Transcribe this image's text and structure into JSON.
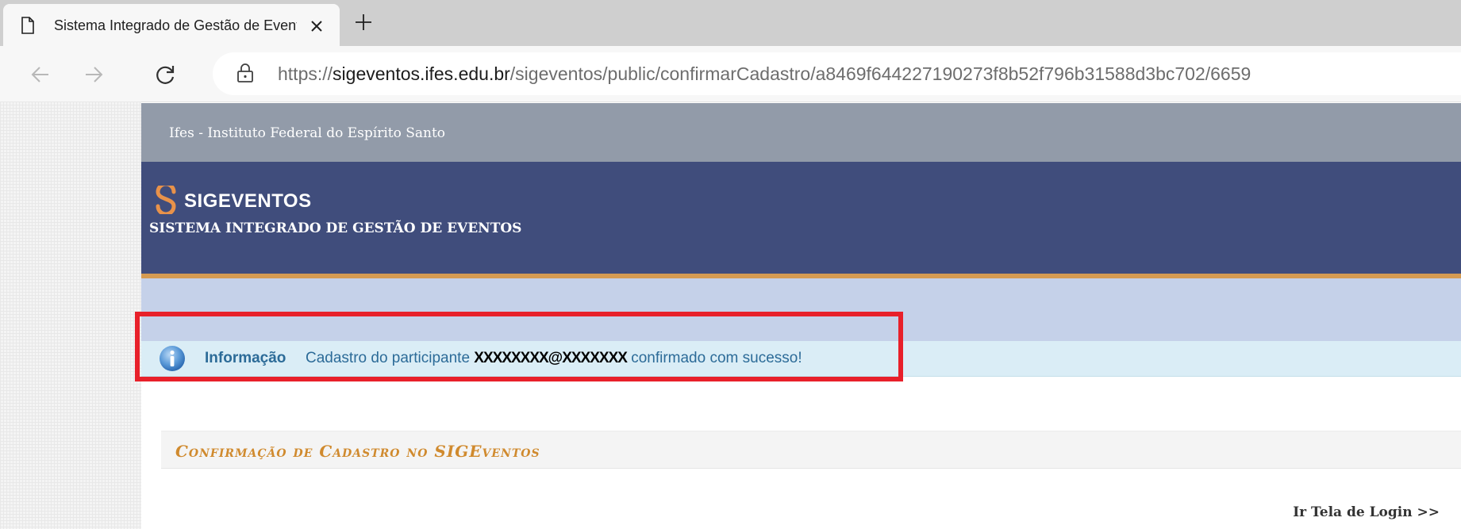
{
  "browser": {
    "tab_title": "Sistema Integrado de Gestão de Eventos",
    "url_scheme": "https://",
    "url_host": "sigeventos.ifes.edu.br",
    "url_path": "/sigeventos/public/confirmarCadastro/a8469f644227190273f8b52f796b31588d3bc702/6659"
  },
  "page": {
    "institution": "Ifes - Instituto Federal do Espírito Santo",
    "brand": "SIGEVENTOS",
    "subtitle": "SISTEMA INTEGRADO DE GESTÃO DE EVENTOS",
    "info": {
      "label": "Informação",
      "message_prefix": "Cadastro do participante",
      "masked_value": "XXXXXXXX@XXXXXXX",
      "message_suffix": "confirmado com sucesso!"
    },
    "panel_title": "Confirmação de Cadastro no SIGEventos",
    "login_link": "Ir Tela de Login >>"
  },
  "colors": {
    "institution_bar": "#929ba9",
    "header": "#404d7c",
    "accent_orange": "#d59b52",
    "info_bg": "#daedf6",
    "info_text": "#2c6b98",
    "highlight": "#e8202a"
  },
  "icons": [
    "document-icon",
    "close-icon",
    "plus-icon",
    "back-arrow-icon",
    "forward-arrow-icon",
    "reload-icon",
    "lock-icon",
    "sigeventos-logo-icon",
    "info-icon"
  ]
}
